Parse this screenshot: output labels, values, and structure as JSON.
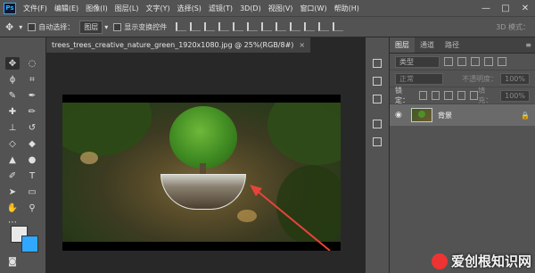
{
  "app": {
    "logo": "Ps"
  },
  "menu": [
    "文件(F)",
    "编辑(E)",
    "图像(I)",
    "图层(L)",
    "文字(Y)",
    "选择(S)",
    "滤镜(T)",
    "3D(D)",
    "视图(V)",
    "窗口(W)",
    "帮助(H)"
  ],
  "window_controls": {
    "minimize": "—",
    "maximize": "□",
    "close": "✕"
  },
  "options": {
    "auto_select_label": "自动选择：",
    "auto_select_value": "图层",
    "transform_label": "显示变换控件",
    "mode3d_label": "3D 模式："
  },
  "document": {
    "tab_title": "trees_trees_creative_nature_green_1920x1080.jpg @ 25%(RGB/8#)",
    "close": "×"
  },
  "panel": {
    "tabs": [
      "图层",
      "通道",
      "路径"
    ],
    "kind_label": "类型",
    "blend_mode": "正常",
    "opacity_label": "不透明度：",
    "opacity_value": "100%",
    "lock_label": "锁定：",
    "fill_label": "填充：",
    "fill_value": "100%",
    "layer_name": "背景"
  },
  "watermark": {
    "text": "爱创根知识网"
  },
  "colors": {
    "accent": "#31a8ff",
    "annotation_arrow": "#e8433a"
  }
}
